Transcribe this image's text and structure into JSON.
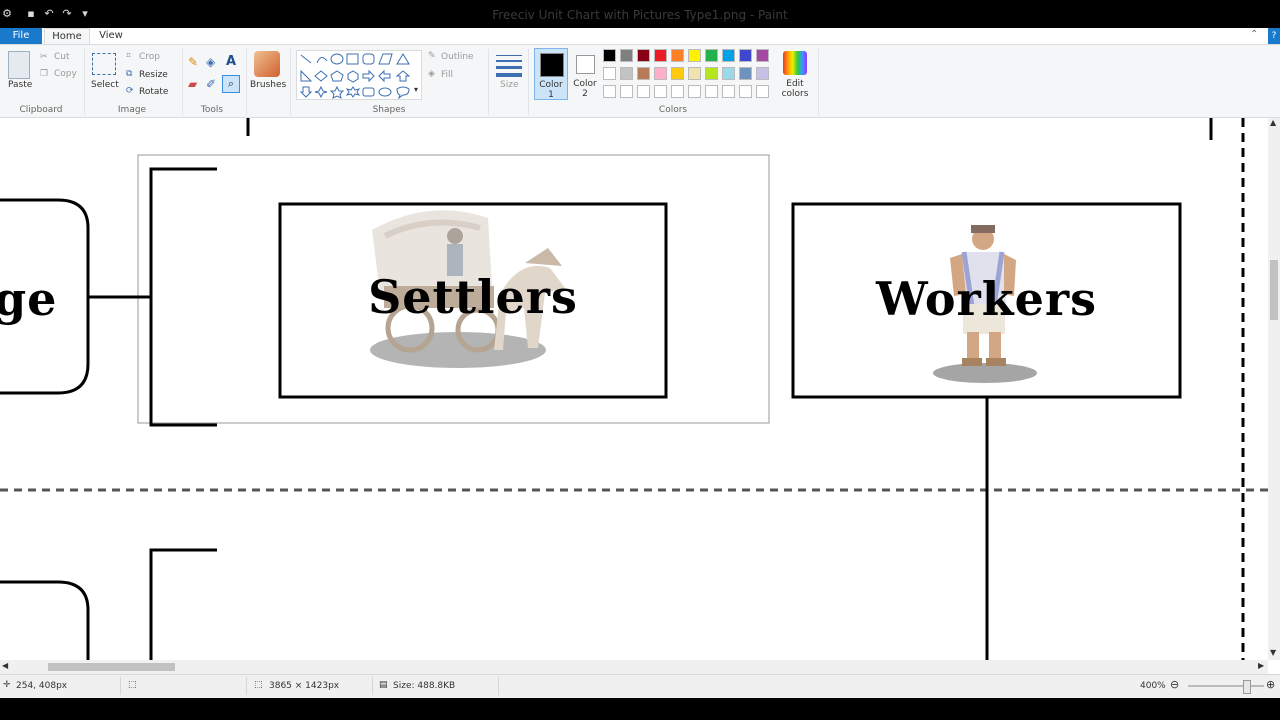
{
  "window": {
    "title": "Freeciv Unit Chart with Pictures Type1.png - Paint"
  },
  "tabs": {
    "file": "File",
    "home": "Home",
    "view": "View"
  },
  "ribbon": {
    "clipboard": {
      "label": "Clipboard",
      "paste": "Paste",
      "cut": "Cut",
      "copy": "Copy"
    },
    "image": {
      "label": "Image",
      "select": "Select",
      "crop": "Crop",
      "resize": "Resize",
      "rotate": "Rotate"
    },
    "tools": {
      "label": "Tools",
      "text_glyph": "A"
    },
    "brushes": {
      "label": "Brushes"
    },
    "shapes": {
      "label": "Shapes",
      "outline": "Outline",
      "fill": "Fill"
    },
    "size": {
      "label": "Size"
    },
    "colors": {
      "label": "Colors",
      "color1_line1": "Color",
      "color1_line2": "1",
      "color2_line1": "Color",
      "color2_line2": "2",
      "edit_line1": "Edit",
      "edit_line2": "colors",
      "color1_value": "#000000",
      "color2_value": "#ffffff",
      "palette_row1": [
        "#000000",
        "#7f7f7f",
        "#880015",
        "#ed1c24",
        "#ff7f27",
        "#fff200",
        "#22b14c",
        "#00a2e8",
        "#3f48cc",
        "#a349a4"
      ],
      "palette_row2": [
        "#ffffff",
        "#c3c3c3",
        "#b97a57",
        "#ffaec9",
        "#ffc90e",
        "#efe4b0",
        "#b5e61d",
        "#99d9ea",
        "#7092be",
        "#c8bfe7"
      ],
      "palette_row3": [
        "#ffffff",
        "#ffffff",
        "#ffffff",
        "#ffffff",
        "#ffffff",
        "#ffffff",
        "#ffffff",
        "#ffffff",
        "#ffffff",
        "#ffffff"
      ]
    }
  },
  "canvas": {
    "left_box_partial": "ge",
    "settlers_label": "Settlers",
    "workers_label": "Workers"
  },
  "statusbar": {
    "cursor_pos": "254, 408px",
    "image_dimensions": "3865 × 1423px",
    "file_size": "Size: 488.8KB",
    "zoom": "400%",
    "zoom_fraction": 0.78
  }
}
